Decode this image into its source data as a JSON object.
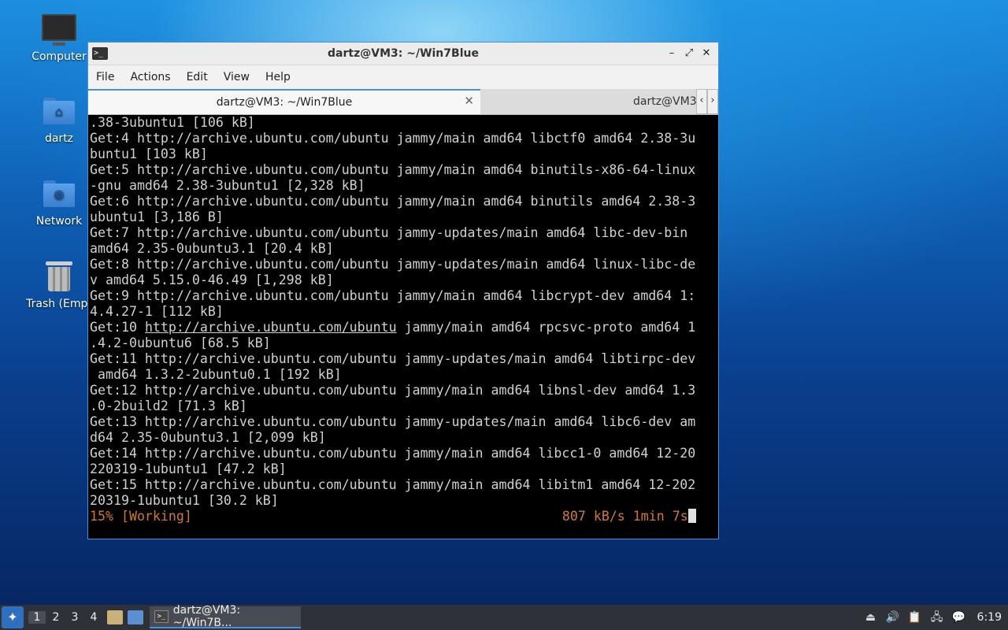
{
  "desktop": {
    "icons": [
      {
        "label": "Computer",
        "icon": "computer-icon"
      },
      {
        "label": "dartz",
        "icon": "home-folder-icon"
      },
      {
        "label": "Network",
        "icon": "network-folder-icon"
      },
      {
        "label": "Trash (Empt",
        "icon": "trash-icon"
      }
    ]
  },
  "window": {
    "title": "dartz@VM3: ~/Win7Blue",
    "controls": {
      "minimize": "–",
      "maximize": "⤢",
      "close": "✕"
    },
    "menu": [
      "File",
      "Actions",
      "Edit",
      "View",
      "Help"
    ],
    "tabs": [
      {
        "label": "dartz@VM3: ~/Win7Blue",
        "close": "✕"
      },
      {
        "label": "dartz@VM3"
      }
    ],
    "tab_scroll": {
      "left": "‹",
      "right": "›"
    }
  },
  "terminal": {
    "lines": [
      ".38-3ubuntu1 [106 kB]",
      "Get:4 http://archive.ubuntu.com/ubuntu jammy/main amd64 libctf0 amd64 2.38-3u",
      "buntu1 [103 kB]",
      "Get:5 http://archive.ubuntu.com/ubuntu jammy/main amd64 binutils-x86-64-linux",
      "-gnu amd64 2.38-3ubuntu1 [2,328 kB]",
      "Get:6 http://archive.ubuntu.com/ubuntu jammy/main amd64 binutils amd64 2.38-3",
      "ubuntu1 [3,186 B]",
      "Get:7 http://archive.ubuntu.com/ubuntu jammy-updates/main amd64 libc-dev-bin",
      "amd64 2.35-0ubuntu3.1 [20.4 kB]",
      "Get:8 http://archive.ubuntu.com/ubuntu jammy-updates/main amd64 linux-libc-de",
      "v amd64 5.15.0-46.49 [1,298 kB]",
      "Get:9 http://archive.ubuntu.com/ubuntu jammy/main amd64 libcrypt-dev amd64 1:",
      "4.4.27-1 [112 kB]"
    ],
    "line10": {
      "prefix": "Get:10 ",
      "link": "http://archive.ubuntu.com/ubuntu",
      "suffix": " jammy/main amd64 rpcsvc-proto amd64 1"
    },
    "lines2": [
      ".4.2-0ubuntu6 [68.5 kB]",
      "Get:11 http://archive.ubuntu.com/ubuntu jammy-updates/main amd64 libtirpc-dev",
      " amd64 1.3.2-2ubuntu0.1 [192 kB]",
      "Get:12 http://archive.ubuntu.com/ubuntu jammy/main amd64 libnsl-dev amd64 1.3",
      ".0-2build2 [71.3 kB]",
      "Get:13 http://archive.ubuntu.com/ubuntu jammy-updates/main amd64 libc6-dev am",
      "d64 2.35-0ubuntu3.1 [2,099 kB]",
      "Get:14 http://archive.ubuntu.com/ubuntu jammy/main amd64 libcc1-0 amd64 12-20",
      "220319-1ubuntu1 [47.2 kB]",
      "Get:15 http://archive.ubuntu.com/ubuntu jammy/main amd64 libitm1 amd64 12-202",
      "20319-1ubuntu1 [30.2 kB]"
    ],
    "status_left": "15% [Working]",
    "status_right": "807 kB/s 1min 7s",
    "status_color": "#d07a30"
  },
  "taskbar": {
    "start_icon": "whisker-menu-icon",
    "workspaces": [
      "1",
      "2",
      "3",
      "4"
    ],
    "active_task": "dartz@VM3: ~/Win7B...",
    "clock": "6:19",
    "accent": "#4a90d9"
  }
}
